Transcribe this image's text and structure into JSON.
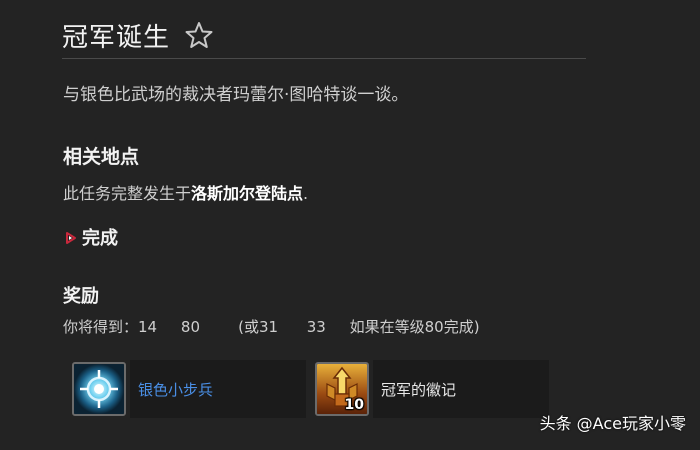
{
  "quest": {
    "title": "冠军诞生",
    "description": "与银色比武场的裁决者玛蕾尔·图哈特谈一谈。"
  },
  "location": {
    "heading": "相关地点",
    "text_prefix": "此任务完整发生于",
    "link": "洛斯加尔登陆点",
    "text_suffix": "."
  },
  "completion": {
    "label": "完成"
  },
  "rewards": {
    "heading": "奖励",
    "summary": "你将得到：14     80        (或31      33     如果在等级80完成)",
    "items": [
      {
        "name": "银色小步兵",
        "icon": "argent-squire-icon",
        "count": "",
        "name_color": "#4a8fe6"
      },
      {
        "name": "冠军的徽记",
        "icon": "champions-seal-icon",
        "count": "10",
        "name_color": "#e8e8e8"
      }
    ]
  },
  "watermark": "头条 @Ace玩家小零",
  "colors": {
    "background": "#232323",
    "link_blue": "#4a8fe6",
    "triangle_red": "#c8283c"
  }
}
